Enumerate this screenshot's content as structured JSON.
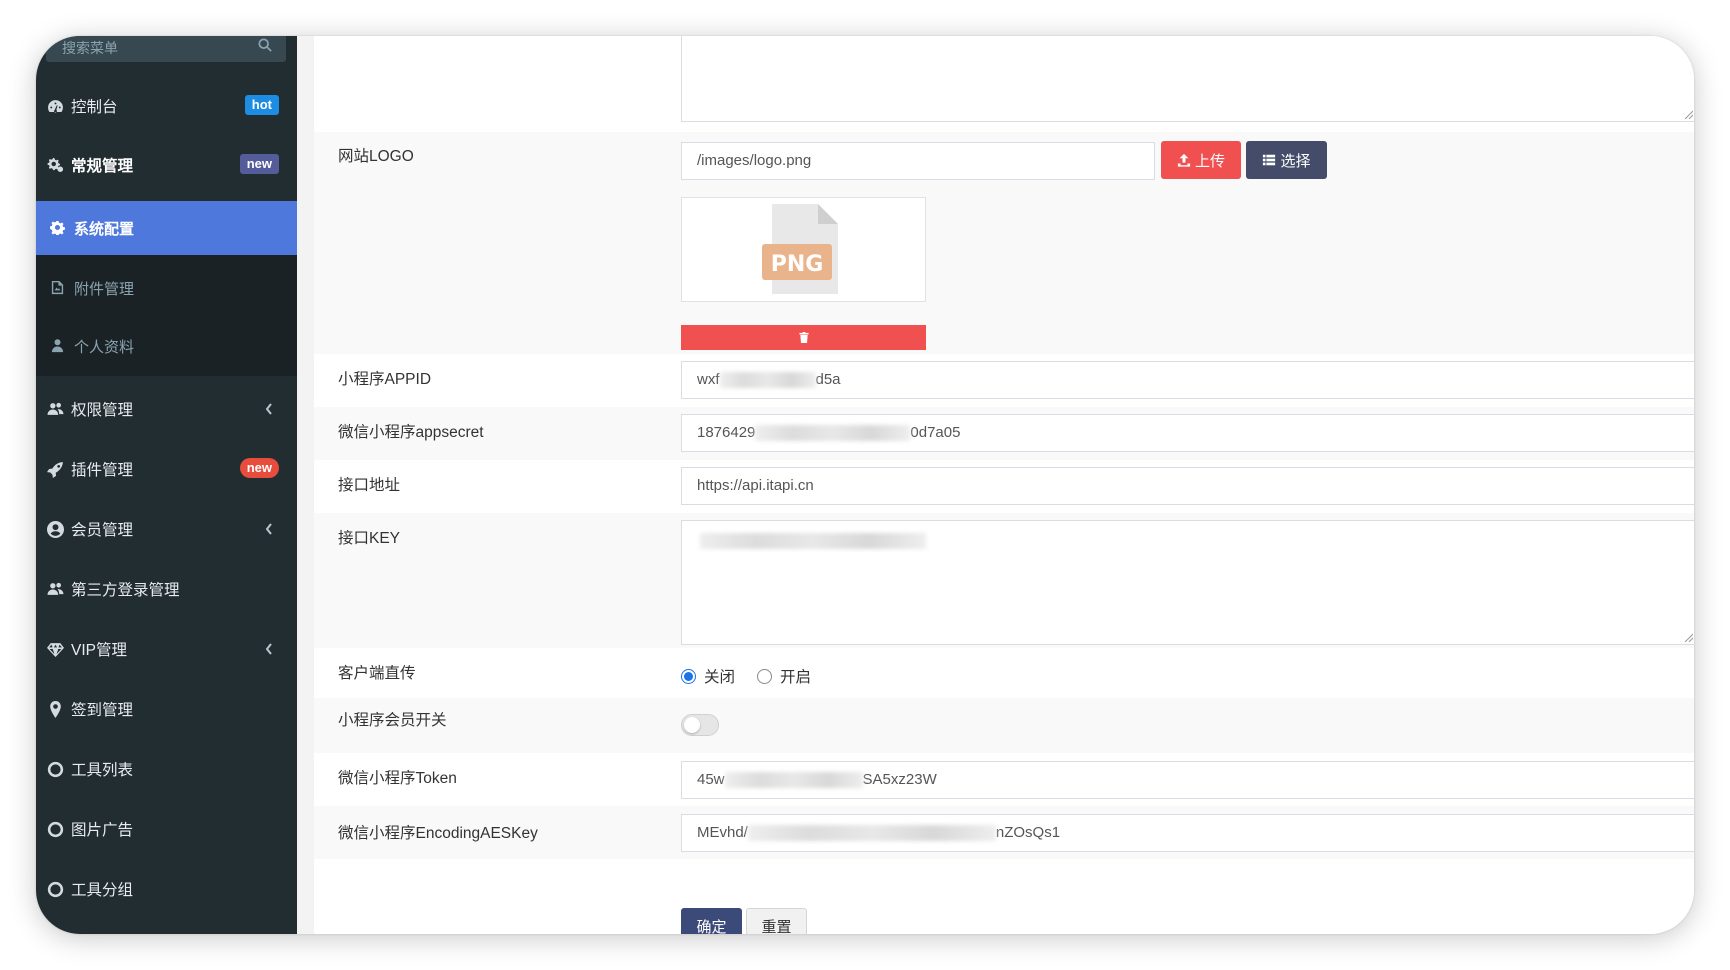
{
  "sidebar": {
    "search_placeholder": "搜索菜单",
    "items": [
      {
        "label": "控制台",
        "icon": "dashboard-icon",
        "badge": "hot"
      },
      {
        "label": "常规管理",
        "icon": "cogs-icon",
        "badge": "new"
      },
      {
        "label": "权限管理",
        "icon": "users-icon"
      },
      {
        "label": "插件管理",
        "icon": "rocket-icon",
        "badge": "new"
      },
      {
        "label": "会员管理",
        "icon": "user-circle-icon"
      },
      {
        "label": "第三方登录管理",
        "icon": "users-icon"
      },
      {
        "label": "VIP管理",
        "icon": "diamond-icon"
      },
      {
        "label": "签到管理",
        "icon": "map-marker-icon"
      },
      {
        "label": "工具列表",
        "icon": "circle-icon"
      },
      {
        "label": "图片广告",
        "icon": "circle-icon"
      },
      {
        "label": "工具分组",
        "icon": "circle-icon"
      }
    ],
    "sub_items": [
      {
        "label": "系统配置",
        "icon": "gear-icon",
        "active": true
      },
      {
        "label": "附件管理",
        "icon": "file-image-icon"
      },
      {
        "label": "个人资料",
        "icon": "user-icon"
      }
    ]
  },
  "form": {
    "logo": {
      "label": "网站LOGO",
      "value": "/images/logo.png",
      "upload_label": "上传",
      "choose_label": "选择",
      "preview_text": "PNG"
    },
    "appid": {
      "label": "小程序APPID",
      "value_start": "wxf",
      "value_end": "d5a"
    },
    "appsecret": {
      "label": "微信小程序appsecret",
      "value_start": "1876429",
      "value_end": "0d7a05"
    },
    "api_url": {
      "label": "接口地址",
      "value": "https://api.itapi.cn"
    },
    "api_key": {
      "label": "接口KEY"
    },
    "client_upload": {
      "label": "客户端直传",
      "options": [
        "关闭",
        "开启"
      ],
      "selected": "关闭"
    },
    "member_switch": {
      "label": "小程序会员开关",
      "enabled": false
    },
    "token": {
      "label": "微信小程序Token",
      "value_start": "45w",
      "value_end": "SA5xz23W"
    },
    "aes_key": {
      "label": "微信小程序EncodingAESKey",
      "value_start": "MEvhd/",
      "value_end": "nZOsQs1"
    },
    "submit_label": "确定",
    "reset_label": "重置"
  },
  "colors": {
    "sidebar_bg": "#222d32",
    "active_item": "#4f78dd",
    "upload_button": "#f05050",
    "choose_button": "#444c6a",
    "badge_hot": "#1d8de4"
  }
}
